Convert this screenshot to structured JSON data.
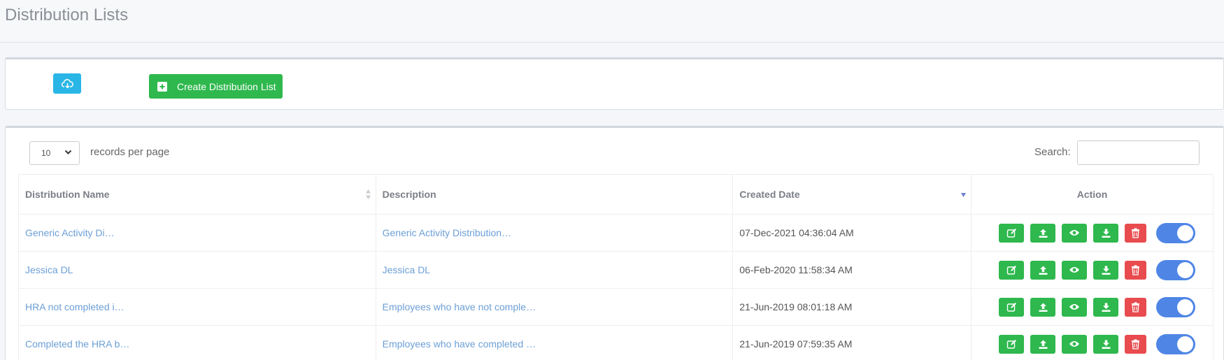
{
  "page": {
    "title": "Distribution Lists"
  },
  "toolbar": {
    "create_label": "Create Distribution List"
  },
  "list_controls": {
    "page_length": "10",
    "records_label": "records per page",
    "search_label": "Search:",
    "search_value": ""
  },
  "table": {
    "headers": {
      "name": "Distribution Name",
      "description": "Description",
      "created": "Created Date",
      "action": "Action"
    },
    "rows": [
      {
        "name": "Generic Activity Di…",
        "description": "Generic Activity Distribution…",
        "created": "07-Dec-2021 04:36:04 AM",
        "enabled": true
      },
      {
        "name": "Jessica DL",
        "description": "Jessica DL",
        "created": "06-Feb-2020 11:58:34 AM",
        "enabled": true
      },
      {
        "name": "HRA not completed i…",
        "description": "Employees who have not comple…",
        "created": "21-Jun-2019 08:01:18 AM",
        "enabled": true
      },
      {
        "name": "Completed the HRA b…",
        "description": "Employees who have completed …",
        "created": "21-Jun-2019 07:59:35 AM",
        "enabled": true
      }
    ]
  },
  "colors": {
    "primary_green": "#2eb84d",
    "danger_red": "#e84c4f",
    "info_blue": "#29b6e6",
    "toggle_on": "#4f86e6",
    "link": "#6c9fd6"
  }
}
